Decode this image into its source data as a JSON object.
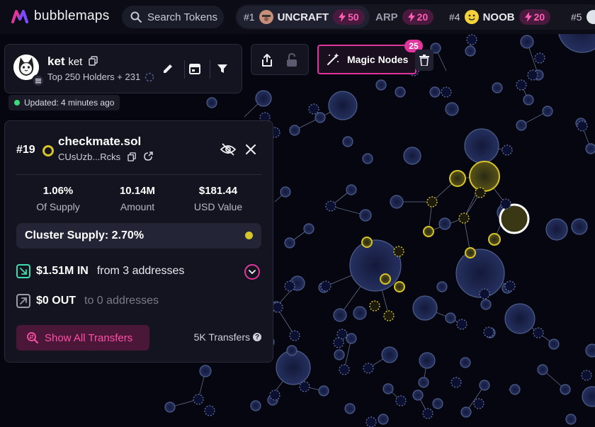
{
  "app": {
    "name": "bubblemaps",
    "search_placeholder": "Search Tokens"
  },
  "trending": [
    {
      "rank": "#1",
      "name": "UNCRAFT",
      "score": "50"
    },
    {
      "rank": "",
      "name": "ARP",
      "score": "20"
    },
    {
      "rank": "#4",
      "name": "NOOB",
      "score": "20"
    },
    {
      "rank": "#5",
      "name": "",
      "score": ""
    }
  ],
  "token": {
    "name": "ket",
    "symbol": "ket",
    "subtitle": "Top 250 Holders + 231",
    "updated": "Updated: 4 minutes ago"
  },
  "magic_nodes": {
    "label": "Magic Nodes",
    "count": "25"
  },
  "holder": {
    "rank": "#19",
    "name": "checkmate.sol",
    "address": "CUsUzb...Rcks",
    "stats": [
      {
        "value": "1.06%",
        "label": "Of Supply"
      },
      {
        "value": "10.14M",
        "label": "Amount"
      },
      {
        "value": "$181.44",
        "label": "USD Value"
      }
    ],
    "cluster_supply": "Cluster Supply: 2.70%",
    "in_amount": "$1.51M IN",
    "in_from": "from 3 addresses",
    "out_amount": "$0 OUT",
    "out_to": "to 0 addresses",
    "show_transfers": "Show All Transfers",
    "transfers_count": "5K Transfers"
  },
  "colors": {
    "background": "#05060f",
    "accent_pink": "#e0369b",
    "cluster_yellow": "#d6c42a",
    "bubble_fill": "#1a2550",
    "bubble_stroke": "#4d5d8a"
  }
}
